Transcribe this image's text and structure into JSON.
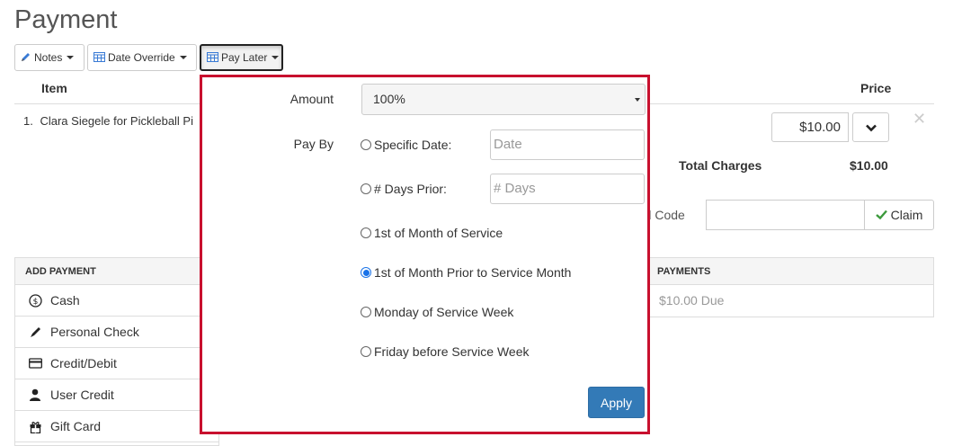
{
  "page": {
    "title": "Payment"
  },
  "toolbar": {
    "notes_label": "Notes",
    "date_override_label": "Date Override",
    "pay_later_label": "Pay Later"
  },
  "items_table": {
    "headers": {
      "item": "Item",
      "price": "Price"
    },
    "rows": [
      {
        "number": "1.",
        "description": "Clara Siegele for Pickleball Pi",
        "price": "$10.00"
      }
    ]
  },
  "totals": {
    "label": "Total Charges",
    "value": "$10.00"
  },
  "coupon": {
    "label": "rd Code",
    "claim_label": "Claim"
  },
  "add_payment": {
    "header": "ADD PAYMENT",
    "methods": [
      {
        "label": "Cash",
        "icon": "cash-icon"
      },
      {
        "label": "Personal Check",
        "icon": "pen-icon"
      },
      {
        "label": "Credit/Debit",
        "icon": "credit-card-icon"
      },
      {
        "label": "User Credit",
        "icon": "user-icon"
      },
      {
        "label": "Gift Card",
        "icon": "gift-icon"
      }
    ]
  },
  "payments": {
    "header": "PAYMENTS",
    "due": "$10.00 Due"
  },
  "pay_later_popover": {
    "amount_label": "Amount",
    "amount_value": "100%",
    "pay_by_label": "Pay By",
    "options": {
      "specific_date": "Specific Date:",
      "days_prior": "# Days Prior:",
      "first_of_month": "1st of Month of Service",
      "first_of_month_prior": "1st of Month Prior to Service Month",
      "monday_of_week": "Monday of Service Week",
      "friday_before_week": "Friday before Service Week"
    },
    "selected_option": "first_of_month_prior",
    "date_placeholder": "Date",
    "days_placeholder": "# Days",
    "apply_label": "Apply"
  },
  "colors": {
    "accent": "#337ab7",
    "popover_border": "#c8102e",
    "check_green": "#3c9a3c"
  }
}
